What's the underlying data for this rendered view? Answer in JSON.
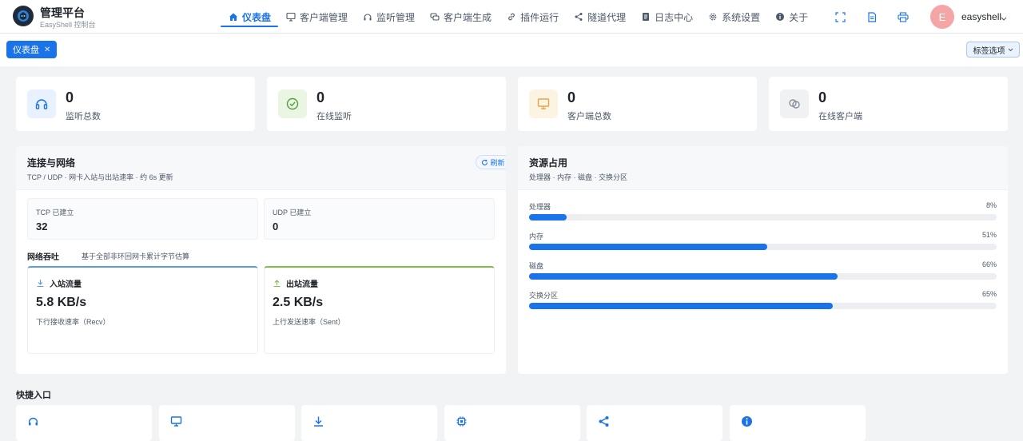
{
  "brand": {
    "title": "管理平台",
    "subtitle": "EasyShell 控制台"
  },
  "nav": [
    {
      "label": "仪表盘",
      "icon": "home-icon",
      "active": true
    },
    {
      "label": "客户端管理",
      "icon": "monitor-icon"
    },
    {
      "label": "监听管理",
      "icon": "headset-icon"
    },
    {
      "label": "客户端生成",
      "icon": "chat-icon"
    },
    {
      "label": "插件运行",
      "icon": "link-icon"
    },
    {
      "label": "隧道代理",
      "icon": "share-icon"
    },
    {
      "label": "日志中心",
      "icon": "document-icon"
    },
    {
      "label": "系统设置",
      "icon": "gear-icon"
    },
    {
      "label": "关于",
      "icon": "info-icon"
    }
  ],
  "user": {
    "initial": "E",
    "name": "easyshell"
  },
  "tabs": {
    "active_label": "仪表盘",
    "options_label": "标签选项"
  },
  "stats": [
    {
      "value": "0",
      "label": "监听总数",
      "icon": "headset-icon",
      "color": "#1a73e8",
      "bg": "#e8f1fd"
    },
    {
      "value": "0",
      "label": "在线监听",
      "icon": "check-circle-icon",
      "color": "#52a23a",
      "bg": "#eaf5e4"
    },
    {
      "value": "0",
      "label": "客户端总数",
      "icon": "monitor-icon",
      "color": "#e0a84a",
      "bg": "#fdf3e3"
    },
    {
      "value": "0",
      "label": "在线客户端",
      "icon": "link-circle-icon",
      "color": "#86909c",
      "bg": "#f0f1f3"
    }
  ],
  "network": {
    "title": "连接与网络",
    "subtitle": "TCP / UDP · 网卡入站与出站速率 · 约 6s 更新",
    "refresh_label": "刷新",
    "tcp_label": "TCP 已建立",
    "tcp_value": "32",
    "udp_label": "UDP 已建立",
    "udp_value": "0",
    "throughput_title": "网络吞吐",
    "throughput_note": "基于全部非环回网卡累计字节估算",
    "inbound": {
      "title": "入站流量",
      "value": "5.8 KB/s",
      "sub": "下行接收速率（Recv）"
    },
    "outbound": {
      "title": "出站流量",
      "value": "2.5 KB/s",
      "sub": "上行发送速率（Sent）"
    }
  },
  "resources": {
    "title": "资源占用",
    "subtitle": "处理器 · 内存 · 磁盘 · 交换分区",
    "items": [
      {
        "label": "处理器",
        "pct_text": "8%",
        "value": 8
      },
      {
        "label": "内存",
        "pct_text": "51%",
        "value": 51
      },
      {
        "label": "磁盘",
        "pct_text": "66%",
        "value": 66
      },
      {
        "label": "交换分区",
        "pct_text": "65%",
        "value": 65
      }
    ]
  },
  "quick": {
    "title": "快捷入口",
    "items": [
      {
        "icon": "headset-icon"
      },
      {
        "icon": "monitor-icon"
      },
      {
        "icon": "download-icon"
      },
      {
        "icon": "chip-icon"
      },
      {
        "icon": "share-icon"
      },
      {
        "icon": "info-icon"
      }
    ]
  },
  "colors": {
    "accent": "#1a73e8",
    "inbound": "#5b9be6",
    "outbound": "#7cc04a"
  }
}
